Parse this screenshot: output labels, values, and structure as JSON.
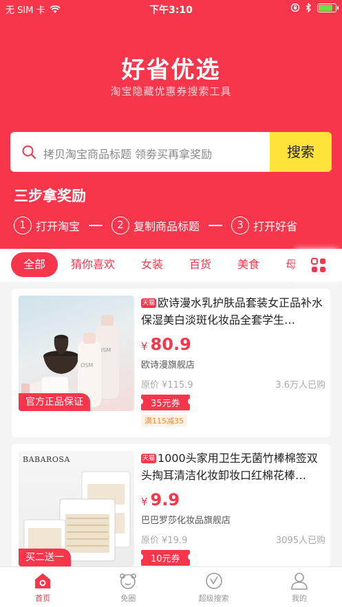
{
  "status_bar": {
    "carrier": "无 SIM 卡",
    "time": "下午3:10"
  },
  "header": {
    "title": "好省优选",
    "subtitle": "淘宝隐藏优惠券搜索工具"
  },
  "search": {
    "placeholder": "拷贝淘宝商品标题 领劵买再拿奖励",
    "button_label": "搜索"
  },
  "steps": {
    "title": "三步拿奖励",
    "items": [
      {
        "num": "1",
        "label": "打开淘宝"
      },
      {
        "num": "2",
        "label": "复制商品标题"
      },
      {
        "num": "3",
        "label": "打开好省"
      }
    ]
  },
  "tabs": {
    "items": [
      "全部",
      "猜你喜欢",
      "女装",
      "百货",
      "美食",
      "母"
    ],
    "active_index": 0
  },
  "products": [
    {
      "platform_badge": "天猫",
      "title": "欧诗漫水乳护肤品套装女正品补水保湿美白淡斑化妆品全套学生…",
      "currency": "¥",
      "price": "80.9",
      "shop": "欧诗漫旗舰店",
      "original_price": "原价 ¥115.9",
      "sold": "3.6万人已购",
      "coupon": "35元券",
      "promo": "满115减35",
      "image_badge": "官方正品保证"
    },
    {
      "platform_badge": "天猫",
      "title": "1000头家用卫生无菌竹棒棉签双头掏耳清洁化妆卸妆口红棉花棒…",
      "currency": "¥",
      "price": "9.9",
      "shop": "巴巴罗莎化妆品旗舰店",
      "original_price": "原价 ¥19.9",
      "sold": "3095人已购",
      "coupon": "10元券",
      "image_badge": "买二送一",
      "image_brand": "BABAROSA"
    }
  ],
  "bottom_nav": {
    "items": [
      "首页",
      "免圈",
      "超级搜索",
      "我的"
    ],
    "active_index": 0
  },
  "colors": {
    "brand_red": "#f7364b",
    "search_yellow": "#fde23a"
  }
}
